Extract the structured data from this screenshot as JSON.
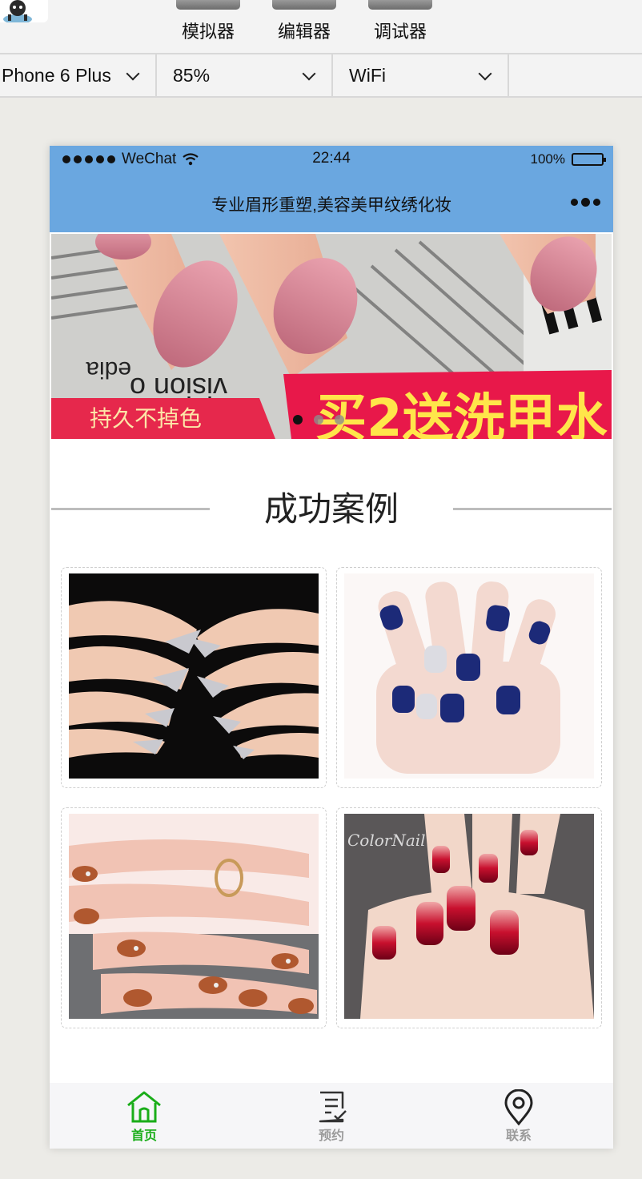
{
  "toolbar": {
    "tools": [
      "模拟器",
      "编辑器",
      "调试器"
    ]
  },
  "selectors": {
    "device": "Phone 6 Plus",
    "zoom": "85%",
    "network": "WiFi"
  },
  "status_bar": {
    "carrier": "WeChat",
    "time": "22:44",
    "battery": "100%"
  },
  "navbar": {
    "title": "专业眉形重塑,美容美甲纹绣化妆"
  },
  "banner": {
    "left_text": "持久不掉色",
    "right_text": "买2送洗甲水",
    "paper_text_1": "vision o",
    "paper_text_2": "edia",
    "slide_count": 3,
    "active_slide": 1
  },
  "section": {
    "title": "成功案例"
  },
  "cases": [
    {
      "name": "glitter-french-nails"
    },
    {
      "name": "navy-blue-nails"
    },
    {
      "name": "copper-rhinestone-nails"
    },
    {
      "name": "red-gradient-nails",
      "watermark": "ColorNail"
    }
  ],
  "tabbar": {
    "items": [
      {
        "label": "首页",
        "icon": "home-icon",
        "active": true
      },
      {
        "label": "预约",
        "icon": "form-icon",
        "active": false
      },
      {
        "label": "联系",
        "icon": "location-pin-icon",
        "active": false
      }
    ]
  },
  "colors": {
    "nav_blue": "#6aa7e0",
    "tab_active": "#1aad19",
    "tab_inactive": "#9b9b9b"
  }
}
